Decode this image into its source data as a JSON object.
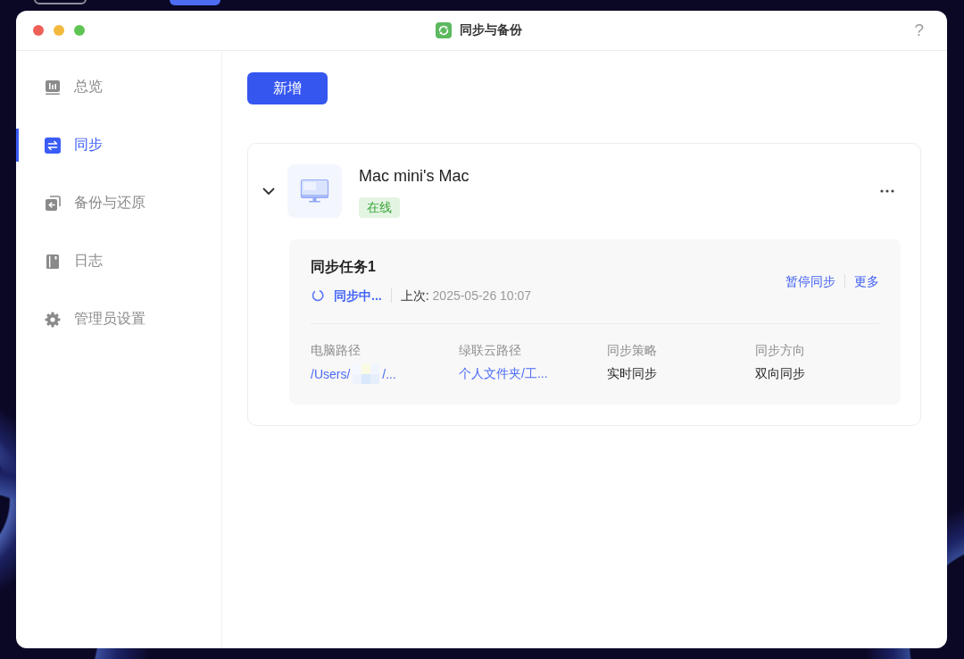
{
  "window": {
    "title": "同步与备份",
    "help": "?"
  },
  "sidebar": {
    "items": [
      {
        "label": "总览",
        "selected": false
      },
      {
        "label": "同步",
        "selected": true
      },
      {
        "label": "备份与还原",
        "selected": false
      },
      {
        "label": "日志",
        "selected": false
      },
      {
        "label": "管理员设置",
        "selected": false
      }
    ]
  },
  "toolbar": {
    "add_button": "新增"
  },
  "devices": [
    {
      "name": "Mac mini's Mac",
      "status": "在线",
      "online": true,
      "expanded": true,
      "tasks": [
        {
          "title": "同步任务1",
          "status": "同步中...",
          "syncing": true,
          "last_label": "上次:",
          "last_time": "2025-05-26 10:07",
          "actions": [
            "暂停同步",
            "更多"
          ],
          "fields": [
            {
              "label": "电脑路径",
              "kind": "link",
              "value": "/Users/",
              "redacted": true,
              "value_tail": "/..."
            },
            {
              "label": "绿联云路径",
              "kind": "link",
              "value": "个人文件夹/工..."
            },
            {
              "label": "同步策略",
              "kind": "text",
              "value": "实时同步"
            },
            {
              "label": "同步方向",
              "kind": "text",
              "value": "双向同步"
            }
          ]
        }
      ]
    }
  ]
}
